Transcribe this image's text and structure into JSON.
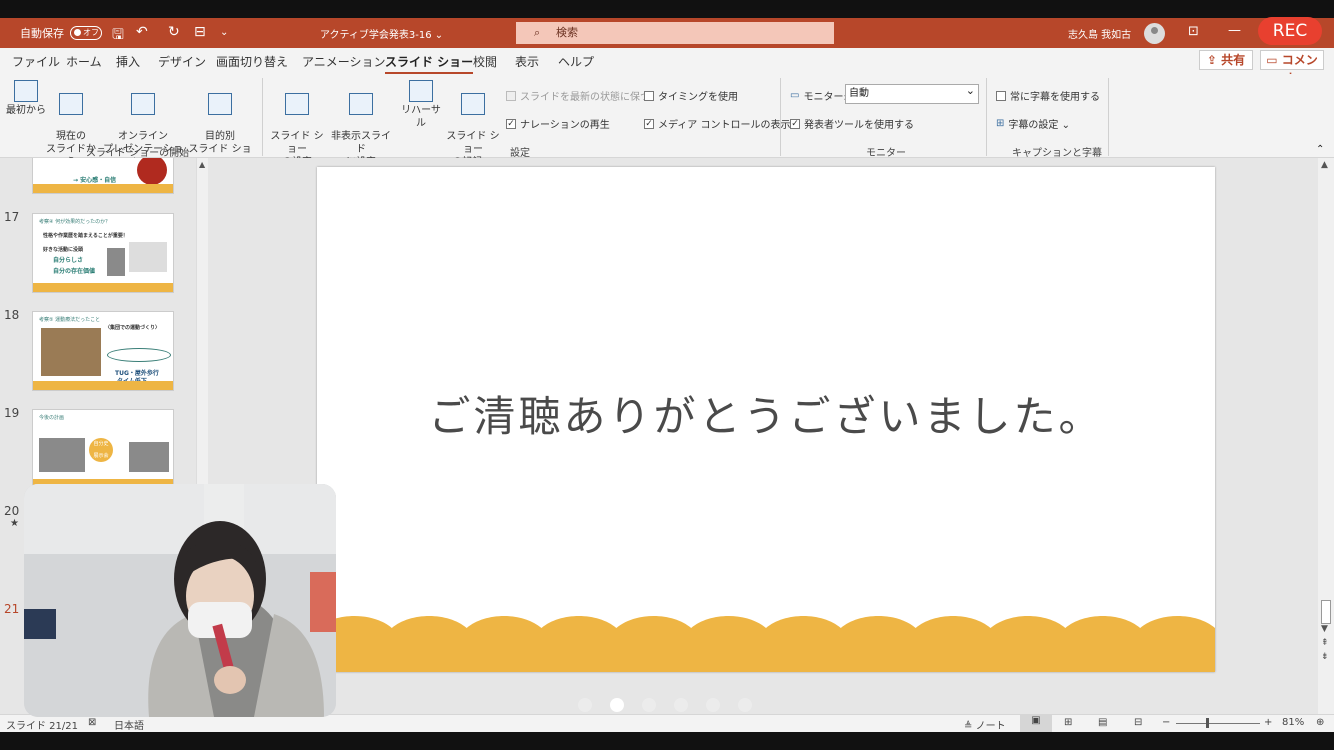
{
  "titlebar": {
    "autosave_label": "自動保存",
    "autosave_state": "オフ",
    "doc_title": "アクティブ学会発表3-16 ⌄",
    "search_placeholder": "検索",
    "user_name": "志久島 我如古",
    "rec_label": "REC"
  },
  "menu": {
    "tabs": [
      "ファイル",
      "ホーム",
      "挿入",
      "デザイン",
      "画面切り替え",
      "アニメーション",
      "スライド ショー",
      "校閲",
      "表示",
      "ヘルプ"
    ],
    "active_tab": "スライド ショー",
    "share_label": "共有",
    "comment_label": "コメント"
  },
  "ribbon": {
    "start_group": {
      "label": "スライド ショーの開始",
      "from_start": "最初から",
      "from_current": "現在の\nスライドから",
      "online": "オンライン\nプレゼンテーション ⌄",
      "custom": "目的別\nスライド ショー ⌄"
    },
    "setup_group": {
      "label": "設定",
      "setup_show": "スライド ショー\nの設定",
      "hide_slide": "非表示スライド\nに設定",
      "rehearse": "リハーサル",
      "record": "スライド ショー\nの記録 ⌄",
      "keep_updated": "スライドを最新の状態に保つ",
      "use_timings": "タイミングを使用",
      "play_narration": "ナレーションの再生",
      "media_controls": "メディア コントロールの表示"
    },
    "monitor_group": {
      "label": "モニター",
      "monitor_label": "モニター:",
      "monitor_value": "自動",
      "presenter_view": "発表者ツールを使用する"
    },
    "caption_group": {
      "label": "キャプションと字幕",
      "always_subtitles": "常に字幕を使用する",
      "subtitle_settings": "字幕の設定 ⌄"
    }
  },
  "thumbnails": [
    {
      "num": "",
      "title": "",
      "lines": [
        "→ 安心感・自信"
      ]
    },
    {
      "num": "17",
      "title": "考察④ 何が効果的だったのか？",
      "lines": [
        "性格や作業歴を踏まえることが重要！",
        "好きな活動に没頭",
        "自分らしさ",
        "自分の存在価値"
      ]
    },
    {
      "num": "18",
      "title": "考察⑤ 運動療法だったこと",
      "lines": [
        "〈集団での運動づくり〉",
        "TUG・屋外歩行",
        "タイム低下"
      ]
    },
    {
      "num": "19",
      "title": "今後の計画",
      "lines": [
        "自分史",
        "展示会"
      ]
    },
    {
      "num": "20",
      "star": "★"
    },
    {
      "num": "21"
    }
  ],
  "slide": {
    "text": "ご清聴ありがとうございました。",
    "wave_color": "#eeb544"
  },
  "statusbar": {
    "slide_info": "スライド 21/21",
    "language": "日本語",
    "notes": "ノート",
    "zoom": "81%"
  },
  "colors": {
    "accent": "#b7472a",
    "rec": "#e8402f"
  }
}
